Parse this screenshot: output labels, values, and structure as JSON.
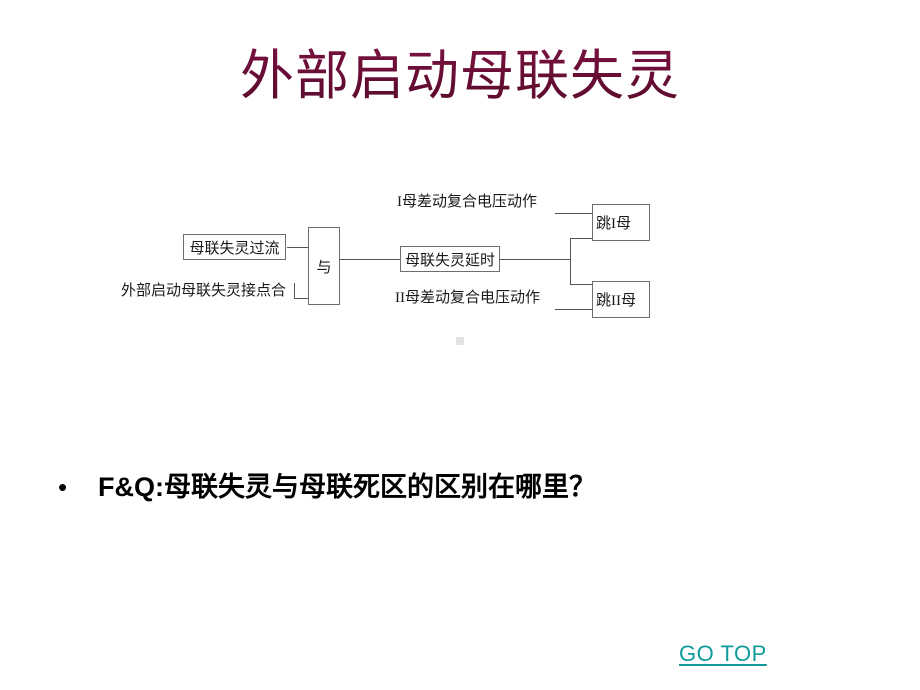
{
  "slide": {
    "title": "外部启动母联失灵",
    "title_color": "#6b1039",
    "background_color": "#ffffff"
  },
  "diagram": {
    "name": "母联失灵逻辑图",
    "input_box_label": "母联失灵过流",
    "contact_input_label": "外部启动母联失灵接点合",
    "and_gate_label": "与",
    "delay_box_label": "母联失灵延时",
    "condition_upper_label": "I母差动复合电压动作",
    "condition_lower_label": "II母差动复合电压动作",
    "output_upper_label": "跳I母",
    "output_lower_label": "跳II母",
    "line_color": "#555555",
    "box_border_color": "#6e6e6e"
  },
  "bullet": {
    "marker": "•",
    "text": "F&Q:母联失灵与母联死区的区别在哪里？"
  },
  "footer": {
    "go_top_label": "GO TOP",
    "go_top_color": "#0f9b9b"
  }
}
